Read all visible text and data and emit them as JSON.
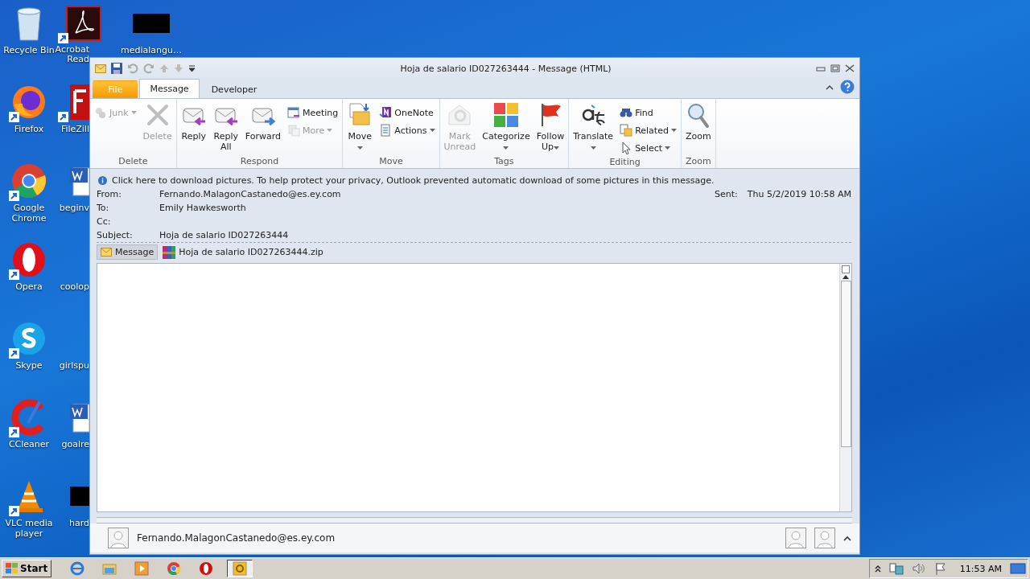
{
  "desktop_icons": [
    {
      "label": "Recycle Bin"
    },
    {
      "label": "Firefox"
    },
    {
      "label": "Google Chrome"
    },
    {
      "label": "Opera"
    },
    {
      "label": "Skype"
    },
    {
      "label": "CCleaner"
    },
    {
      "label": "VLC media player"
    },
    {
      "label": "Acrobat Read"
    },
    {
      "label": "FileZill"
    },
    {
      "label": "beginv"
    },
    {
      "label": "coolop"
    },
    {
      "label": "girlspu"
    },
    {
      "label": "goalre"
    },
    {
      "label": "hard"
    },
    {
      "label": "medialangu…"
    }
  ],
  "window": {
    "title": "Hoja de salario ID027263444 - Message (HTML)",
    "tabs": [
      {
        "label": "File",
        "kind": "file",
        "selected": false
      },
      {
        "label": "Message",
        "kind": "tab",
        "selected": true
      },
      {
        "label": "Developer",
        "kind": "tab",
        "selected": false
      }
    ],
    "ribbon": [
      {
        "label": "Delete",
        "buttons": [
          {
            "label": "Junk",
            "kind": "small",
            "disabled": true,
            "dropdown": true
          },
          {
            "label": "Delete",
            "kind": "large",
            "disabled": true,
            "dropdown": false
          }
        ]
      },
      {
        "label": "Respond",
        "buttons": [
          {
            "label": "Reply",
            "kind": "large",
            "disabled": false,
            "dropdown": false
          },
          {
            "label": "Reply All",
            "kind": "large",
            "disabled": false,
            "dropdown": false
          },
          {
            "label": "Forward",
            "kind": "large",
            "disabled": false,
            "dropdown": false
          },
          {
            "label": "Meeting",
            "kind": "small",
            "disabled": false,
            "dropdown": false
          },
          {
            "label": "More",
            "kind": "small",
            "disabled": true,
            "dropdown": true
          }
        ]
      },
      {
        "label": "Move",
        "buttons": [
          {
            "label": "Move",
            "kind": "large",
            "disabled": false,
            "dropdown": true
          },
          {
            "label": "OneNote",
            "kind": "small",
            "disabled": false,
            "dropdown": false
          },
          {
            "label": "Actions",
            "kind": "small",
            "disabled": false,
            "dropdown": true
          }
        ]
      },
      {
        "label": "Tags",
        "buttons": [
          {
            "label": "Mark Unread",
            "kind": "large",
            "disabled": true,
            "dropdown": false
          },
          {
            "label": "Categorize",
            "kind": "large",
            "disabled": false,
            "dropdown": true
          },
          {
            "label": "Follow Up",
            "kind": "large",
            "disabled": false,
            "dropdown": true
          }
        ]
      },
      {
        "label": "Editing",
        "buttons": [
          {
            "label": "Translate",
            "kind": "large",
            "disabled": false,
            "dropdown": true
          },
          {
            "label": "Find",
            "kind": "small",
            "disabled": false,
            "dropdown": false
          },
          {
            "label": "Related",
            "kind": "small",
            "disabled": false,
            "dropdown": true
          },
          {
            "label": "Select",
            "kind": "small",
            "disabled": false,
            "dropdown": true
          }
        ]
      },
      {
        "label": "Zoom",
        "buttons": [
          {
            "label": "Zoom",
            "kind": "large",
            "disabled": false,
            "dropdown": false
          }
        ]
      }
    ],
    "info_bar": "Click here to download pictures. To help protect your privacy, Outlook prevented automatic download of some pictures in this message.",
    "header": [
      {
        "label": "From:",
        "value": "Fernando.MalagonCastanedo@es.ey.com"
      },
      {
        "label": "To:",
        "value": "Emily Hawkesworth"
      },
      {
        "label": "Cc:"
      },
      {
        "label": "Subject:",
        "value": "Hoja de salario ID027263444"
      }
    ],
    "sent": {
      "label": "Sent:",
      "value": "Thu 5/2/2019 10:58 AM"
    },
    "attachments": [
      {
        "label": "Message",
        "kind": "message",
        "selected": true
      },
      {
        "label": "Hoja de salario ID027263444.zip",
        "kind": "archive",
        "selected": false
      }
    ],
    "people_pane": {
      "name": "Fernando.MalagonCastanedo@es.ey.com"
    }
  },
  "taskbar": {
    "start": "Start",
    "apps": [
      {
        "selected": false
      },
      {
        "selected": false
      },
      {
        "selected": false
      },
      {
        "selected": false
      },
      {
        "selected": false
      },
      {
        "selected": true
      }
    ],
    "clock": "11:53 AM"
  }
}
